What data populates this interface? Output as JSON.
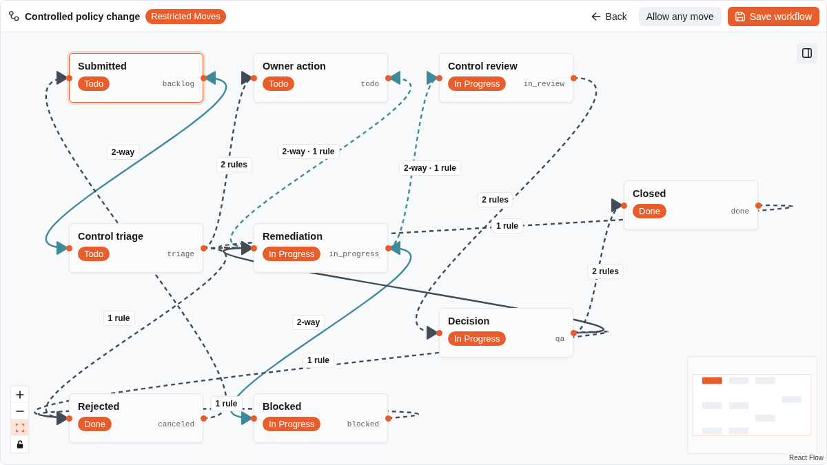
{
  "header": {
    "title": "Controlled policy change",
    "badge": "Restricted Moves",
    "actions": [
      {
        "kind": "back",
        "label": "Back"
      },
      {
        "kind": "toggle_mode",
        "label": "Allow any move"
      },
      {
        "kind": "save",
        "label": "Save workflow"
      }
    ]
  },
  "canvas": {
    "nodes": [
      {
        "title": "Submitted",
        "status": "Todo",
        "key": "backlog",
        "selected": true
      },
      {
        "title": "Owner action",
        "status": "Todo",
        "key": "todo",
        "selected": false
      },
      {
        "title": "Control review",
        "status": "In Progress",
        "key": "in_review",
        "selected": false
      },
      {
        "title": "Closed",
        "status": "Done",
        "key": "done",
        "selected": false
      },
      {
        "title": "Control triage",
        "status": "Todo",
        "key": "triage",
        "selected": false
      },
      {
        "title": "Remediation",
        "status": "In Progress",
        "key": "in_progress",
        "selected": false
      },
      {
        "title": "Decision",
        "status": "In Progress",
        "key": "qa",
        "selected": false
      },
      {
        "title": "Rejected",
        "status": "Done",
        "key": "canceled",
        "selected": false
      },
      {
        "title": "Blocked",
        "status": "In Progress",
        "key": "blocked",
        "selected": false
      }
    ],
    "edges": [
      {
        "kind": "two_way",
        "label": "2-way"
      },
      {
        "kind": "one_way_dashed",
        "label": "2 rules"
      },
      {
        "kind": "two_way_dashed",
        "label": "2-way · 1 rule"
      },
      {
        "kind": "two_way_dashed",
        "label": "2-way · 1 rule"
      },
      {
        "kind": "one_way_dashed",
        "label": "2 rules"
      },
      {
        "kind": "one_way_dashed",
        "label": "1 rule"
      },
      {
        "kind": "one_way_dashed",
        "label": "2 rules"
      },
      {
        "kind": "one_way_dashed",
        "label": "1 rule"
      },
      {
        "kind": "two_way",
        "label": "2-way"
      },
      {
        "kind": "one_way_dashed",
        "label": "1 rule"
      },
      {
        "kind": "one_way_dashed",
        "label": "1 rule"
      },
      {
        "kind": "one_way_dashed"
      },
      {
        "kind": "one_way_dashed"
      },
      {
        "kind": "one_way"
      }
    ],
    "controls": [
      {
        "kind": "zoom_in",
        "selected": false
      },
      {
        "kind": "zoom_out",
        "selected": false
      },
      {
        "kind": "fit_view",
        "selected": true
      },
      {
        "kind": "lock",
        "selected": false
      }
    ],
    "attribution": "React Flow"
  }
}
